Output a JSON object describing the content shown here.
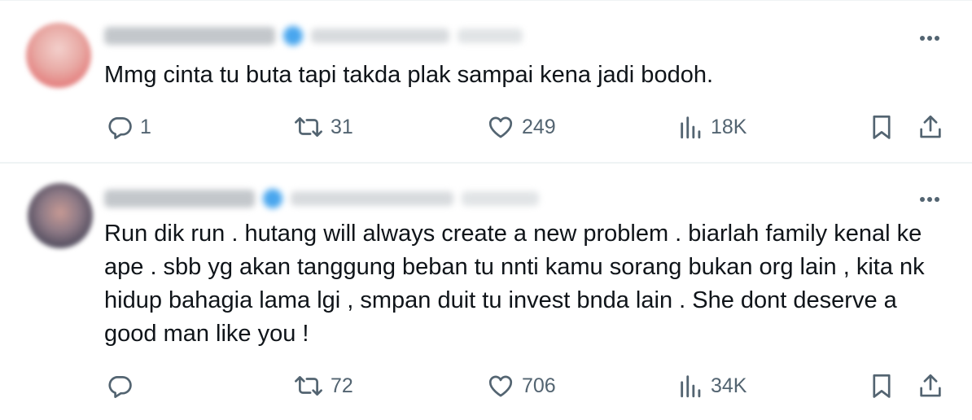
{
  "tweets": [
    {
      "text": "Mmg cinta tu buta tapi takda plak sampai kena jadi bodoh.",
      "replies": "1",
      "retweets": "31",
      "likes": "249",
      "views": "18K"
    },
    {
      "text": "Run dik run . hutang will always create a new problem . biarlah family kenal ke ape . sbb yg akan tanggung beban tu nnti kamu sorang bukan org lain , kita nk hidup bahagia lama lgi , smpan duit tu invest bnda lain . She dont deserve a good man like you !",
      "replies": "",
      "retweets": "72",
      "likes": "706",
      "views": "34K"
    }
  ],
  "icons": {
    "reply": "reply-icon",
    "retweet": "retweet-icon",
    "like": "heart-icon",
    "views": "views-icon",
    "bookmark": "bookmark-icon",
    "share": "share-icon",
    "more": "more-icon",
    "verified": "verified-badge-icon"
  },
  "colors": {
    "text": "#0f1419",
    "secondary": "#536471",
    "divider": "#eff3f4",
    "verified": "#1d9bf0"
  }
}
